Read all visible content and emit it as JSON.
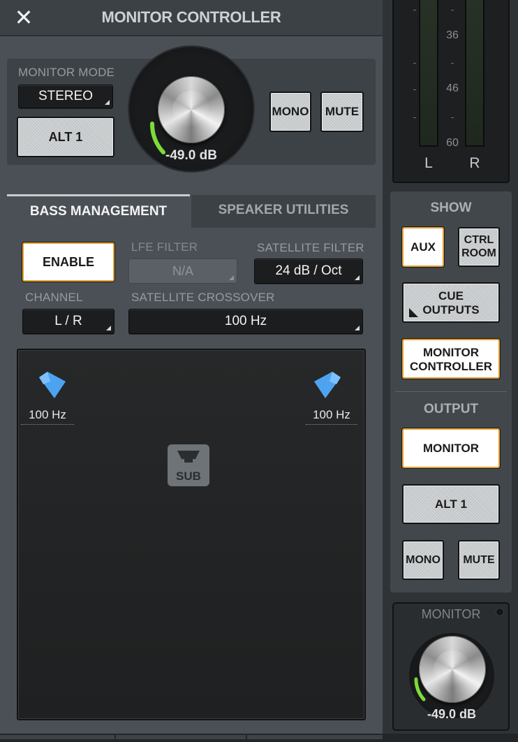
{
  "window": {
    "title": "MONITOR CONTROLLER",
    "close_glyph": "✕"
  },
  "monitor_mode": {
    "label": "MONITOR MODE",
    "mode_value": "STEREO",
    "alt_label": "ALT 1",
    "mono_label": "MONO",
    "mute_label": "MUTE",
    "knob_value": "-49.0 dB"
  },
  "tabs": [
    {
      "label": "BASS MANAGEMENT",
      "active": true
    },
    {
      "label": "SPEAKER UTILITIES",
      "active": false
    }
  ],
  "bass_management": {
    "enable_label": "ENABLE",
    "lfe_filter_label": "LFE FILTER",
    "lfe_filter_value": "N/A",
    "satellite_filter_label": "SATELLITE FILTER",
    "satellite_filter_value": "24 dB / Oct",
    "channel_label": "CHANNEL",
    "channel_value": "L / R",
    "satellite_crossover_label": "SATELLITE CROSSOVER",
    "satellite_crossover_value": "100 Hz",
    "speakers": {
      "left_freq": "100 Hz",
      "right_freq": "100 Hz",
      "sub_label": "SUB"
    }
  },
  "meter": {
    "scale": [
      "36",
      "46",
      "60"
    ],
    "left_label": "L",
    "right_label": "R"
  },
  "show": {
    "label": "SHOW",
    "aux_label": "AUX",
    "ctrl_room_line1": "CTRL",
    "ctrl_room_line2": "ROOM",
    "cue_line1": "CUE",
    "cue_line2": "OUTPUTS",
    "monitor_ctrl_line1": "MONITOR",
    "monitor_ctrl_line2": "CONTROLLER"
  },
  "output": {
    "label": "OUTPUT",
    "monitor_label": "MONITOR",
    "alt_label": "ALT 1",
    "mono_label": "MONO",
    "mute_label": "MUTE"
  },
  "monitor_knob": {
    "label": "MONITOR",
    "value": "-49.0 dB"
  },
  "colors": {
    "panel_bg": "#4a5055",
    "accent_orange": "#e2a033",
    "knob_green": "#7ddc3a",
    "speaker_blue": "#4da3f0"
  }
}
